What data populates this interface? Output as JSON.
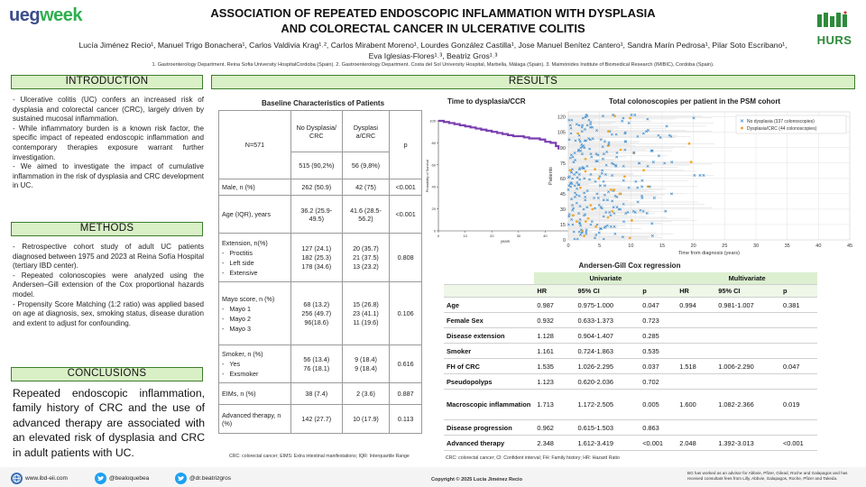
{
  "header": {
    "logo_left_a": "ueg",
    "logo_left_b": "week",
    "title_line1": "ASSOCIATION OF REPEATED ENDOSCOPIC INFLAMMATION WITH DYSPLASIA",
    "title_line2": "AND COLORECTAL CANCER IN ULCERATIVE COLITIS",
    "authors_line1": "Lucía Jiménez Recio¹, Manuel Trigo Bonachera¹, Carlos Valdivia Krag¹˒², Carlos Mirabent Moreno¹, Lourdes González Castilla¹, Jose Manuel Benítez Cantero¹, Sandra Marín Pedrosa¹, Pilar Soto Escribano¹,",
    "authors_line2": "Eva Iglesias-Flores¹˒³, Beatriz Gros¹˒³",
    "affiliations": "1. Gastroenterology Department. Reina Sofia University HospitalCordoba (Spain). 2. Gastroenterology Department. Costa del Sol University Hospital, Marbella, Málaga (Spain). 3. Maimónides Institute of Biomedical Research (IMIBIC), Cordoba (Spain).",
    "logo_right": "HURS"
  },
  "introduction": {
    "heading": "INTRODUCTION",
    "p1": "- Ulcerative colitis (UC) confers an increased risk of dysplasia and colorectal cancer (CRC), largely driven by sustained mucosal inflammation.",
    "p2": "- While inflammatory burden is a known risk factor, the specific impact of repeated endoscopic inflammation and contemporary therapies exposure warrant further investigation.",
    "p3": "- We aimed to investigate the impact of cumulative inflammation in the risk of dysplasia and CRC development in UC."
  },
  "methods": {
    "heading": "METHODS",
    "p1": "- Retrospective cohort study of adult UC patients diagnosed between 1975 and 2023 at Reina Sofía Hospital (tertiary IBD center).",
    "p2": "- Repeated colonoscopies were analyzed using the Andersen–Gill extension of the Cox proportional hazards model.",
    "p3": "- Propensity Score Matching (1:2 ratio) was applied based on age at diagnosis, sex, smoking status, disease duration and extent to adjust for confounding."
  },
  "conclusions": {
    "heading": "CONCLUSIONS",
    "text": "Repeated endoscopic inflammation, family history of CRC and the use of advanced therapy are associated with an elevated risk of dysplasia and CRC in adult patients with UC."
  },
  "results": {
    "heading": "RESULTS",
    "baseline_title": "Baseline Characteristics of Patients",
    "baseline": {
      "n_label": "N=571",
      "col_no": "No Dysplasia/ CRC",
      "col_dys": "Dysplasi a/CRC",
      "col_p": "p",
      "n_no": "515 (90,2%)",
      "n_dys": "56 (9,8%)",
      "male_label": "Male, n (%)",
      "male_no": "262 (50.9)",
      "male_dys": "42 (75)",
      "male_p": "<0.001",
      "age_label": "Age (IQR), years",
      "age_no": "36.2 (25.9-49.5)",
      "age_dys": "41.6 (28.5-56.2)",
      "age_p": "<0.001",
      "ext_label": "Extension, n(%)",
      "ext_a": "Proctitis",
      "ext_b": "Left side",
      "ext_c": "Extensive",
      "ext_no_a": "127 (24.1)",
      "ext_no_b": "182 (25.3)",
      "ext_no_c": "178 (34.6)",
      "ext_dys_a": "20 (35.7)",
      "ext_dys_b": "21 (37.5)",
      "ext_dys_c": "13 (23.2)",
      "ext_p": "0.808",
      "mayo_label": "Mayo score, n (%)",
      "mayo_a": "Mayo 1",
      "mayo_b": "Mayo 2",
      "mayo_c": "Mayo 3",
      "mayo_no_a": "68 (13.2)",
      "mayo_no_b": "256 (49.7)",
      "mayo_no_c": "96(18.6)",
      "mayo_dys_a": "15 (26.8)",
      "mayo_dys_b": "23 (41.1)",
      "mayo_dys_c": "11 (19.6)",
      "mayo_p": "0.106",
      "smk_label": "Smoker, n (%)",
      "smk_a": "Yes",
      "smk_b": "Exsmoker",
      "smk_no_a": "56 (13.4)",
      "smk_no_b": "76 (18.1)",
      "smk_dys_a": "9 (18.4)",
      "smk_dys_b": "9 (18.4)",
      "smk_p": "0.616",
      "eim_label": "EIMs, n (%)",
      "eim_no": "38 (7.4)",
      "eim_dys": "2 (3.6)",
      "eim_p": "0.887",
      "adv_label": "Advanced therapy, n (%)",
      "adv_no": "142 (27.7)",
      "adv_dys": "10 (17.9)",
      "adv_p": "0.113"
    },
    "baseline_footnote": "CRC: colorectal cancer; EIMS: Extra intestinal manifestations; IQR: Interquartile Range",
    "cox_title": "Andersen-Gill Cox regression",
    "cox_group_uni": "Univariate",
    "cox_group_multi": "Multivariate",
    "cox_headers": [
      "HR",
      "95% CI",
      "p",
      "HR",
      "95% CI",
      "p"
    ],
    "cox_rows": [
      {
        "label": "Age",
        "hr": "0.987",
        "ci": "0.975-1.000",
        "p": "0.047",
        "mhr": "0.994",
        "mci": "0.981-1.007",
        "mp": "0.381"
      },
      {
        "label": "Female Sex",
        "hr": "0.932",
        "ci": "0.633-1.373",
        "p": "0.723",
        "mhr": "",
        "mci": "",
        "mp": ""
      },
      {
        "label": "Disease extension",
        "hr": "1.128",
        "ci": "0.904-1.407",
        "p": "0.285",
        "mhr": "",
        "mci": "",
        "mp": ""
      },
      {
        "label": "Smoker",
        "hr": "1.161",
        "ci": "0.724-1.863",
        "p": "0.535",
        "mhr": "",
        "mci": "",
        "mp": ""
      },
      {
        "label": "FH of CRC",
        "hr": "1.535",
        "ci": "1.026-2.295",
        "p": "0.037",
        "mhr": "1.518",
        "mci": "1.006-2.290",
        "mp": "0.047"
      },
      {
        "label": "Pseudopolyps",
        "hr": "1.123",
        "ci": "0.620-2.036",
        "p": "0.702",
        "mhr": "",
        "mci": "",
        "mp": ""
      },
      {
        "label": "Macroscopic inflammation",
        "hr": "1.713",
        "ci": "1.172-2.505",
        "p": "0.005",
        "mhr": "1.600",
        "mci": "1.082-2.366",
        "mp": "0.019"
      },
      {
        "label": "Disease progression",
        "hr": "0.962",
        "ci": "0.615-1.503",
        "p": "0.863",
        "mhr": "",
        "mci": "",
        "mp": ""
      },
      {
        "label": "Advanced therapy",
        "hr": "2.348",
        "ci": "1.612-3.419",
        "p": "<0.001",
        "mhr": "2.048",
        "mci": "1.392-3.013",
        "mp": "<0.001"
      }
    ],
    "cox_footnote": "CRC: colorectal cancer; CI: Confident interval; FH: Family history; HR: Hazard Ratio"
  },
  "chart_data": [
    {
      "type": "line",
      "title": "Time to dysplasia/CCR",
      "xlabel": "years",
      "ylabel": "Probability of Survival",
      "ylim": [
        0,
        100
      ],
      "xlim": [
        0,
        50
      ],
      "y_ticks": [
        0,
        20,
        40,
        60,
        80,
        100
      ],
      "x_ticks": [
        0,
        10,
        20,
        30,
        40,
        50
      ],
      "color": "#7b3fb0",
      "series": [
        {
          "x": [
            0,
            2,
            4,
            6,
            8,
            10,
            12,
            14,
            16,
            18,
            20,
            22,
            24,
            26,
            28,
            30,
            32,
            34,
            36,
            38,
            40,
            42,
            44,
            45
          ],
          "y": [
            100,
            99,
            98,
            97,
            96,
            95,
            94,
            93,
            92,
            91,
            90,
            89,
            88,
            87,
            86,
            86,
            85,
            84,
            84,
            83,
            81,
            80,
            77,
            74
          ]
        }
      ]
    },
    {
      "type": "scatter",
      "title": "Total colonoscopies per patient in the PSM cohort",
      "xlabel": "Time from diagnosis (years)",
      "ylabel": "Patients",
      "xlim": [
        0,
        45
      ],
      "ylim": [
        0,
        125
      ],
      "x_ticks": [
        0,
        5,
        10,
        15,
        20,
        25,
        30,
        35,
        40,
        45
      ],
      "y_ticks": [
        0,
        15,
        30,
        45,
        60,
        75,
        90,
        105,
        120
      ],
      "legend_position": "top-right",
      "series": [
        {
          "name": "No dysplasia (337 colonoscopies)",
          "color": "#3f8fd0",
          "marker": "x"
        },
        {
          "name": "Dysplasia/CRC (44 colonoscopies)",
          "color": "#f5a623",
          "marker": "dot"
        }
      ]
    }
  ],
  "footer": {
    "website": "www.ibd-eii.com",
    "twitter1": "@bealoquebea",
    "twitter2": "@dr.beatrizgros",
    "copyright": "Copyright © 2025 Lucía Jiménez Recio",
    "disclosure": "BG has worked as an advisor for Abbvie, Pfizer, Gilead, Roche and Galapagos and has received consultant fees from Lilly, Abbvie, Galapagos, Roche, Pfizer and Takeda."
  }
}
